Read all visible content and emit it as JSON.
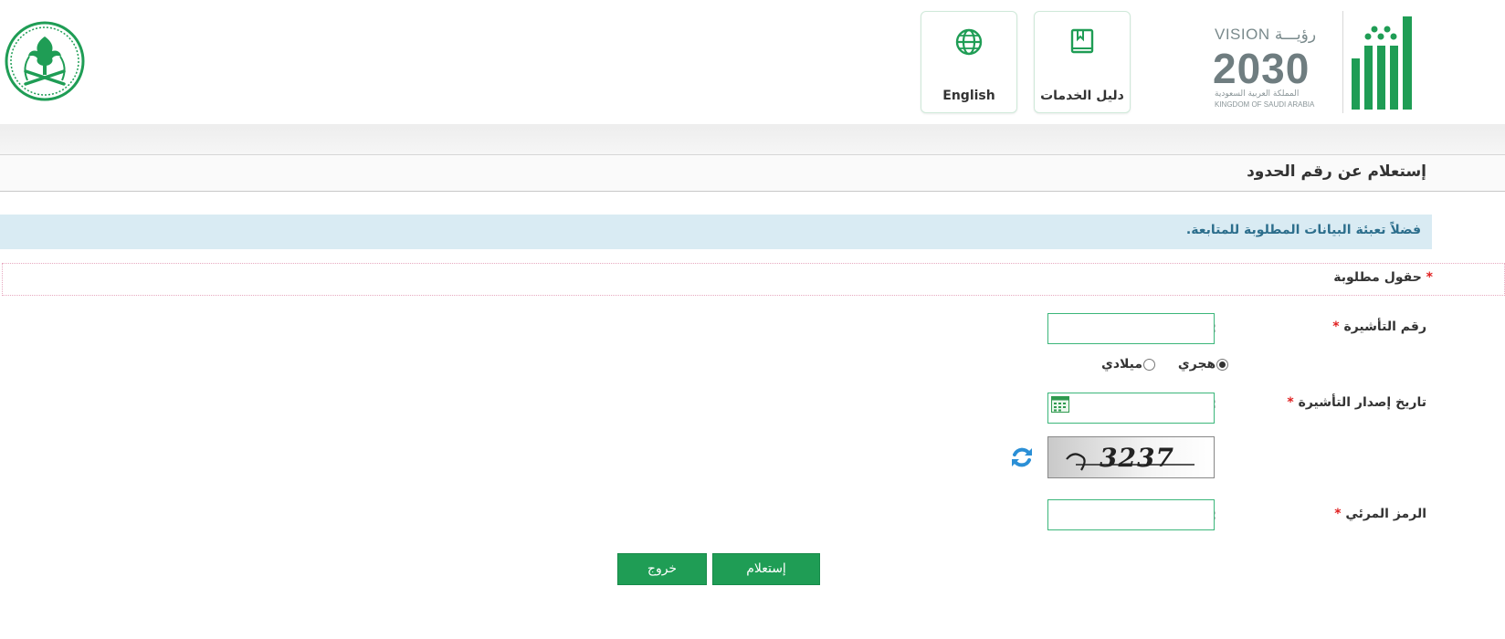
{
  "header": {
    "english_label": "English",
    "services_guide_label": "دليل الخدمات",
    "vision": {
      "top": "VISION رؤيـــة",
      "year": "2030",
      "arabic": "المملكة العربية السعودية",
      "english": "KINGDOM OF SAUDI ARABIA"
    },
    "brand_color": "#1f9d55"
  },
  "page": {
    "title": "إستعلام عن رقم الحدود",
    "info": "فضلاً تعبئة البيانات المطلوبة للمتابعة.",
    "required_note": "حقول مطلوبة",
    "required_star": "*"
  },
  "form": {
    "visa_number_label": "رقم التأشيرة",
    "visa_number_value": "",
    "date_type_options": [
      "هجري",
      "ميلادي"
    ],
    "date_type_selected": "هجري",
    "visa_date_label": "تاريخ إصدار التأشيرة",
    "visa_date_value": "",
    "captcha_text": "3237",
    "captcha_label": "الرمز المرئي",
    "captcha_value": "",
    "colon": ":"
  },
  "actions": {
    "inquire": "إستعلام",
    "exit": "خروج"
  },
  "icons": {
    "emblem": "saudi-emblem-icon",
    "globe": "globe-icon",
    "book": "book-icon",
    "calendar": "calendar-icon",
    "refresh": "refresh-icon",
    "absher": "absher-logo"
  }
}
